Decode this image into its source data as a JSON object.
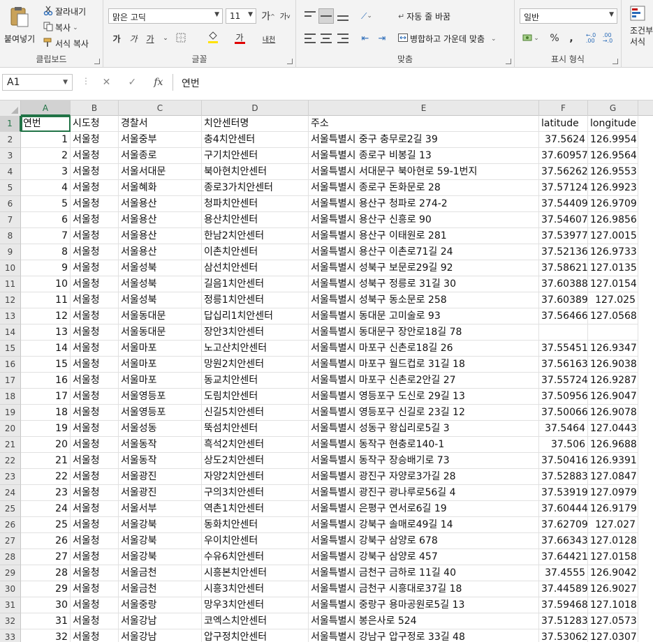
{
  "ribbon": {
    "clipboard": {
      "paste": "붙여넣기",
      "cut": "잘라내기",
      "copy": "복사",
      "format_painter": "서식 복사",
      "group": "클립보드"
    },
    "font": {
      "name": "맑은 고딕",
      "size": "11",
      "group": "글꼴",
      "bold": "가",
      "italic": "가",
      "underline": "가",
      "grow": "가",
      "shrink": "가",
      "font_color_glyph": "가",
      "phonetic": "내천"
    },
    "alignment": {
      "wrap": "자동 줄 바꿈",
      "merge": "병합하고 가운데 맞춤",
      "group": "맞춤"
    },
    "number": {
      "format": "일반",
      "group": "표시 형식",
      "percent": "%",
      "comma": ","
    },
    "styles": {
      "conditional_line1": "조건부",
      "conditional_line2": "서식"
    }
  },
  "formula_bar": {
    "name_box": "A1",
    "fx": "fx",
    "content": "연번"
  },
  "colors": {
    "accent": "#217346",
    "fill_highlight": "#ffe200",
    "font_red": "#e00000"
  },
  "columns": [
    "A",
    "B",
    "C",
    "D",
    "E",
    "F",
    "G"
  ],
  "rows": [
    {
      "n": "1",
      "cells": [
        "연번",
        "시도청",
        "경찰서",
        "치안센터명",
        "주소",
        "latitude",
        "longitude"
      ]
    },
    {
      "n": "2",
      "cells": [
        "1",
        "서울청",
        "서울중부",
        "충4치안센터",
        "서울특별시  중구 충무로2길 39",
        "37.5624",
        "126.9954"
      ]
    },
    {
      "n": "3",
      "cells": [
        "2",
        "서울청",
        "서울종로",
        "구기치안센터",
        "서울특별시  종로구 비봉길 13",
        "37.60957",
        "126.9564"
      ]
    },
    {
      "n": "4",
      "cells": [
        "3",
        "서울청",
        "서울서대문",
        "북아현치안센터",
        "서울특별시  서대문구 북아현로 59-1번지",
        "37.56262",
        "126.9553"
      ]
    },
    {
      "n": "5",
      "cells": [
        "4",
        "서울청",
        "서울혜화",
        "종로3가치안센터",
        "서울특별시  종로구 돈화문로 28",
        "37.57124",
        "126.9923"
      ]
    },
    {
      "n": "6",
      "cells": [
        "5",
        "서울청",
        "서울용산",
        "청파치안센터",
        "서울특별시  용산구 청파로 274-2",
        "37.54409",
        "126.9709"
      ]
    },
    {
      "n": "7",
      "cells": [
        "6",
        "서울청",
        "서울용산",
        "용산치안센터",
        "서울특별시  용산구 신흥로 90",
        "37.54607",
        "126.9856"
      ]
    },
    {
      "n": "8",
      "cells": [
        "7",
        "서울청",
        "서울용산",
        "한남2치안센터",
        "서울특별시  용산구 이태원로 281",
        "37.53977",
        "127.0015"
      ]
    },
    {
      "n": "9",
      "cells": [
        "8",
        "서울청",
        "서울용산",
        "이촌치안센터",
        "서울특별시  용산구 이촌로71길 24",
        "37.52136",
        "126.9733"
      ]
    },
    {
      "n": "10",
      "cells": [
        "9",
        "서울청",
        "서울성북",
        "삼선치안센터",
        "서울특별시  성북구 보문로29길 92",
        "37.58621",
        "127.0135"
      ]
    },
    {
      "n": "11",
      "cells": [
        "10",
        "서울청",
        "서울성북",
        "길음1치안센터",
        "서울특별시  성북구 정릉로 31길 30",
        "37.60388",
        "127.0154"
      ]
    },
    {
      "n": "12",
      "cells": [
        "11",
        "서울청",
        "서울성북",
        "정릉1치안센터",
        "서울특별시  성북구 동소문로 258",
        "37.60389",
        "127.025"
      ]
    },
    {
      "n": "13",
      "cells": [
        "12",
        "서울청",
        "서울동대문",
        "답십리1치안센터",
        "서울특별시  동대문 고미술로 93",
        "37.56466",
        "127.0568"
      ]
    },
    {
      "n": "14",
      "cells": [
        "13",
        "서울청",
        "서울동대문",
        "장안3치안센터",
        "서울특별시  동대문구 장안로18길 78",
        "",
        ""
      ]
    },
    {
      "n": "15",
      "cells": [
        "14",
        "서울청",
        "서울마포",
        "노고산치안센터",
        "서울특별시  마포구 신촌로18길 26",
        "37.55451",
        "126.9347"
      ]
    },
    {
      "n": "16",
      "cells": [
        "15",
        "서울청",
        "서울마포",
        "망원2치안센터",
        "서울특별시  마포구 월드컵로 31길 18",
        "37.56163",
        "126.9038"
      ]
    },
    {
      "n": "17",
      "cells": [
        "16",
        "서울청",
        "서울마포",
        "동교치안센터",
        "서울특별시  마포구 신촌로2안길 27",
        "37.55724",
        "126.9287"
      ]
    },
    {
      "n": "18",
      "cells": [
        "17",
        "서울청",
        "서울영등포",
        "도림치안센터",
        "서울특별시  영등포구 도신로 29길 13",
        "37.50956",
        "126.9047"
      ]
    },
    {
      "n": "19",
      "cells": [
        "18",
        "서울청",
        "서울영등포",
        "신길5치안센터",
        "서울특별시  영등포구 신길로 23길 12",
        "37.50066",
        "126.9078"
      ]
    },
    {
      "n": "20",
      "cells": [
        "19",
        "서울청",
        "서울성동",
        "뚝섬치안센터",
        "서울특별시  성동구 왕십리로5길 3",
        "37.5464",
        "127.0443"
      ]
    },
    {
      "n": "21",
      "cells": [
        "20",
        "서울청",
        "서울동작",
        "흑석2치안센터",
        "서울특별시  동작구 현충로140-1",
        "37.506",
        "126.9688"
      ]
    },
    {
      "n": "22",
      "cells": [
        "21",
        "서울청",
        "서울동작",
        "상도2치안센터",
        "서울특별시  동작구 장승배기로 73",
        "37.50416",
        "126.9391"
      ]
    },
    {
      "n": "23",
      "cells": [
        "22",
        "서울청",
        "서울광진",
        "자양2치안센터",
        "서울특별시  광진구 자양로3가길 28",
        "37.52883",
        "127.0847"
      ]
    },
    {
      "n": "24",
      "cells": [
        "23",
        "서울청",
        "서울광진",
        "구의3치안센터",
        "서울특별시  광진구 광나루로56길 4",
        "37.53919",
        "127.0979"
      ]
    },
    {
      "n": "25",
      "cells": [
        "24",
        "서울청",
        "서울서부",
        "역촌1치안센터",
        "서울특별시  은평구 연서로6길 19",
        "37.60444",
        "126.9179"
      ]
    },
    {
      "n": "26",
      "cells": [
        "25",
        "서울청",
        "서울강북",
        "동화치안센터",
        "서울특별시  강북구 솔매로49길 14",
        "37.62709",
        "127.027"
      ]
    },
    {
      "n": "27",
      "cells": [
        "26",
        "서울청",
        "서울강북",
        "우이치안센터",
        "서울특별시  강북구 삼양로 678",
        "37.66343",
        "127.0128"
      ]
    },
    {
      "n": "28",
      "cells": [
        "27",
        "서울청",
        "서울강북",
        "수유6치안센터",
        "서울특별시  강북구 삼양로 457",
        "37.64421",
        "127.0158"
      ]
    },
    {
      "n": "29",
      "cells": [
        "28",
        "서울청",
        "서울금천",
        "시흥본치안센터",
        "서울특별시  금천구 금하로 11길 40",
        "37.4555",
        "126.9042"
      ]
    },
    {
      "n": "30",
      "cells": [
        "29",
        "서울청",
        "서울금천",
        "시흥3치안센터",
        "서울특별시  금천구 시흥대로37길 18",
        "37.44589",
        "126.9027"
      ]
    },
    {
      "n": "31",
      "cells": [
        "30",
        "서울청",
        "서울중랑",
        "망우3치안센터",
        "서울특별시  중랑구 용마공원로5길 13",
        "37.59468",
        "127.1018"
      ]
    },
    {
      "n": "32",
      "cells": [
        "31",
        "서울청",
        "서울강남",
        "코엑스치안센터",
        "서울특별시  봉은사로 524",
        "37.51283",
        "127.0573"
      ]
    },
    {
      "n": "33",
      "cells": [
        "32",
        "서울청",
        "서울강남",
        "압구정치안센터",
        "서울특별시  강남구 압구정로 33길 48",
        "37.53062",
        "127.0307"
      ]
    }
  ]
}
